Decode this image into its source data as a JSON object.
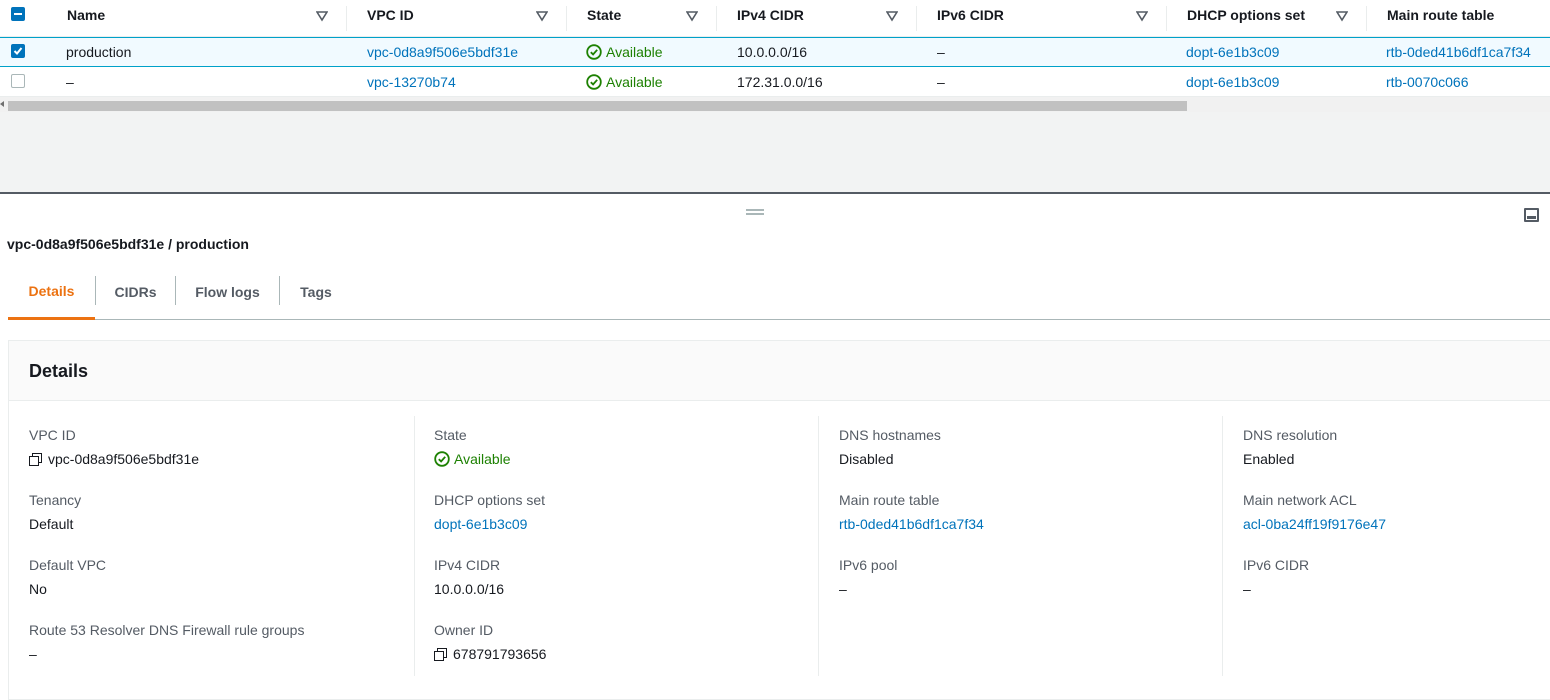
{
  "table": {
    "columns": [
      "Name",
      "VPC ID",
      "State",
      "IPv4 CIDR",
      "IPv6 CIDR",
      "DHCP options set",
      "Main route table"
    ],
    "rows": [
      {
        "name": "production",
        "vpc_id": "vpc-0d8a9f506e5bdf31e",
        "state": "Available",
        "ipv4": "10.0.0.0/16",
        "ipv6": "–",
        "dhcp": "dopt-6e1b3c09",
        "route": "rtb-0ded41b6df1ca7f34",
        "selected": true
      },
      {
        "name": "–",
        "vpc_id": "vpc-13270b74",
        "state": "Available",
        "ipv4": "172.31.0.0/16",
        "ipv6": "–",
        "dhcp": "dopt-6e1b3c09",
        "route": "rtb-0070c066",
        "selected": false
      }
    ]
  },
  "panel": {
    "title": "vpc-0d8a9f506e5bdf31e / production",
    "tabs": [
      "Details",
      "CIDRs",
      "Flow logs",
      "Tags"
    ],
    "active_tab": "Details"
  },
  "details": {
    "heading": "Details",
    "col1": [
      {
        "k": "VPC ID",
        "v": "vpc-0d8a9f506e5bdf31e"
      },
      {
        "k": "Tenancy",
        "v": "Default"
      },
      {
        "k": "Default VPC",
        "v": "No"
      },
      {
        "k": "Route 53 Resolver DNS Firewall rule groups",
        "v": "–"
      }
    ],
    "col2": [
      {
        "k": "State",
        "v": "Available"
      },
      {
        "k": "DHCP options set",
        "v": "dopt-6e1b3c09"
      },
      {
        "k": "IPv4 CIDR",
        "v": "10.0.0.0/16"
      },
      {
        "k": "Owner ID",
        "v": "678791793656"
      }
    ],
    "col3": [
      {
        "k": "DNS hostnames",
        "v": "Disabled"
      },
      {
        "k": "Main route table",
        "v": "rtb-0ded41b6df1ca7f34"
      },
      {
        "k": "IPv6 pool",
        "v": "–"
      }
    ],
    "col4": [
      {
        "k": "DNS resolution",
        "v": "Enabled"
      },
      {
        "k": "Main network ACL",
        "v": "acl-0ba24ff19f9176e47"
      },
      {
        "k": "IPv6 CIDR",
        "v": "–"
      }
    ]
  },
  "colors": {
    "link": "#0073bb",
    "success": "#1d8102",
    "active_tab": "#ec7211"
  }
}
